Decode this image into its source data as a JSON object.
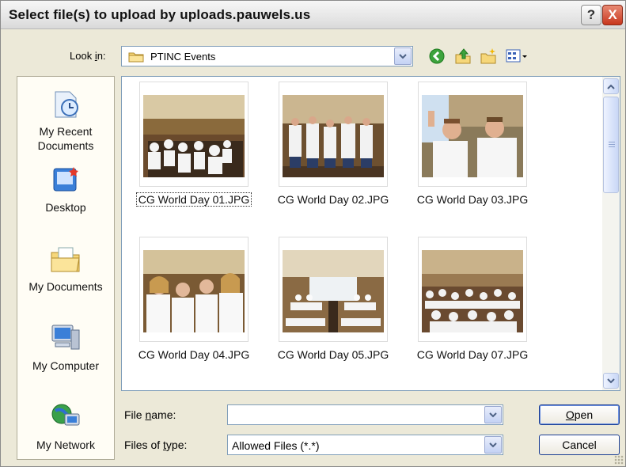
{
  "window": {
    "title": "Select file(s) to upload by uploads.pauwels.us",
    "help_label": "?",
    "close_label": "X"
  },
  "lookin": {
    "label_pre": "Look ",
    "label_accel": "i",
    "label_post": "n:",
    "value": "PTINC Events",
    "toolbar_icons": [
      "back-icon",
      "up-folder-icon",
      "new-folder-icon",
      "view-menu-icon"
    ]
  },
  "places": [
    {
      "label_line1": "My Recent",
      "label_line2": "Documents",
      "icon": "recent-documents-icon"
    },
    {
      "label_line1": "Desktop",
      "label_line2": "",
      "icon": "desktop-icon"
    },
    {
      "label_line1": "My Documents",
      "label_line2": "",
      "icon": "my-documents-icon"
    },
    {
      "label_line1": "My Computer",
      "label_line2": "",
      "icon": "my-computer-icon"
    },
    {
      "label_line1": "My Network",
      "label_line2": "",
      "icon": "my-network-icon"
    }
  ],
  "files": [
    {
      "name": "CG World Day 01.JPG",
      "selected": true
    },
    {
      "name": "CG World Day 02.JPG",
      "selected": false
    },
    {
      "name": "CG World Day 03.JPG",
      "selected": false
    },
    {
      "name": "CG World Day 04.JPG",
      "selected": false
    },
    {
      "name": "CG World Day 05.JPG",
      "selected": false
    },
    {
      "name": "CG World Day 07.JPG",
      "selected": false
    }
  ],
  "filename": {
    "label_pre": "File ",
    "label_accel": "n",
    "label_post": "ame:",
    "value": ""
  },
  "filetype": {
    "label_pre": "Files of ",
    "label_accel": "t",
    "label_post": "ype:",
    "value": "Allowed Files (*.*)"
  },
  "buttons": {
    "open_accel": "O",
    "open_rest": "pen",
    "cancel": "Cancel"
  },
  "colors": {
    "dialog_bg": "#ece9d8",
    "close_red": "#c8361d",
    "border_blue": "#7f9db9"
  }
}
